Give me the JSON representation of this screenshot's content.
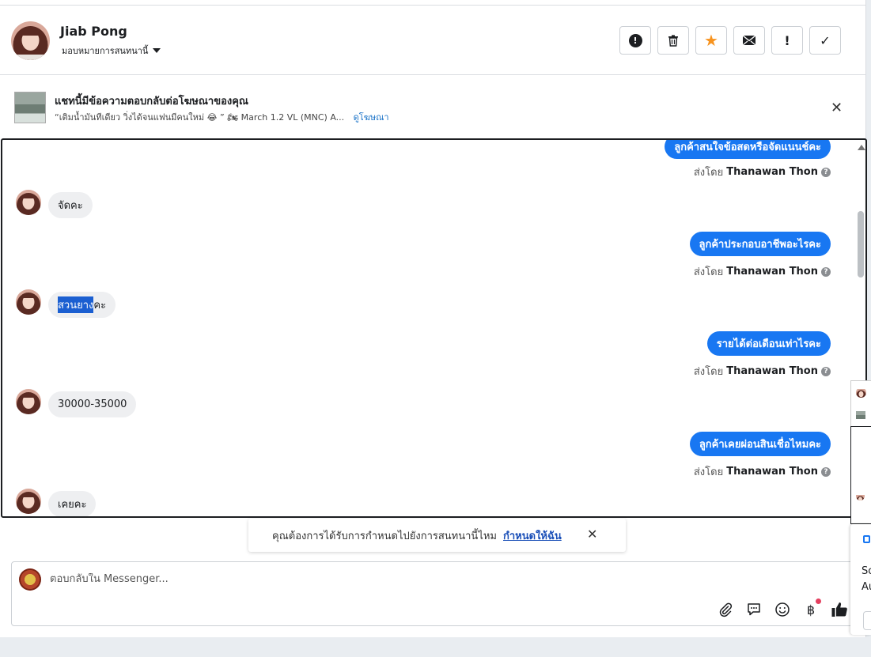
{
  "header": {
    "user_name": "Jiab Pong",
    "assign_label": "มอบหมายการสนทนานี้",
    "actions": [
      {
        "icon": "alert-circle-icon",
        "glyph": "!"
      },
      {
        "icon": "trash-icon",
        "glyph": "🗑"
      },
      {
        "icon": "star-icon",
        "glyph": "★"
      },
      {
        "icon": "mail-icon",
        "glyph": "✉"
      },
      {
        "icon": "exclamation-icon",
        "glyph": "!"
      },
      {
        "icon": "check-icon",
        "glyph": "✓"
      }
    ]
  },
  "ad": {
    "title": "แชทนี้มีข้อความตอบกลับต่อโฆษณาของคุณ",
    "subtitle": "“เติมน้ำมันทีเดียว วิ่งได้จนแฟนมีคนใหม่ 😂 ” 🏍 March 1.2 VL (MNC) A...",
    "link": "ดูโฆษณา",
    "close": "✕"
  },
  "messages": {
    "out_1": "ลูกค้าสนใจข้อสดหรือจัดแนนช์คะ",
    "sent_by_label": "ส่งโดย",
    "sender": "Thanawan Thon",
    "help": "?",
    "in_1": "จัดคะ",
    "out_2": "ลูกค้าประกอบอาชีพอะไรคะ",
    "in_2_highlight": "สวนยาง",
    "in_2_rest": "คะ",
    "out_3": "รายได้ต่อเดือนเท่าไรคะ",
    "in_3": "30000-35000",
    "out_4": "ลูกค้าเคยผ่อนสินเชื่อไหมคะ",
    "in_4": "เคยคะ"
  },
  "toast": {
    "text": "คุณต้องการได้รับการกำหนดไปยังการสนทนานี้ไหม",
    "link": "กำหนดให้ฉัน",
    "close": "✕"
  },
  "composer": {
    "placeholder": "ตอบกลับใน Messenger...",
    "tools": [
      {
        "icon": "paperclip-icon",
        "glyph": "📎"
      },
      {
        "icon": "saved-reply-icon",
        "glyph": "💬"
      },
      {
        "icon": "emoji-icon",
        "glyph": "☺"
      },
      {
        "icon": "baht-payment-icon",
        "glyph": "฿"
      },
      {
        "icon": "thumbs-up-icon",
        "glyph": "👍"
      }
    ]
  },
  "side_panel": {
    "text_1": "So",
    "text_2": "Au"
  },
  "colors": {
    "accent": "#1877f2",
    "star": "#f7931e",
    "highlight": "#1b5fd1"
  }
}
